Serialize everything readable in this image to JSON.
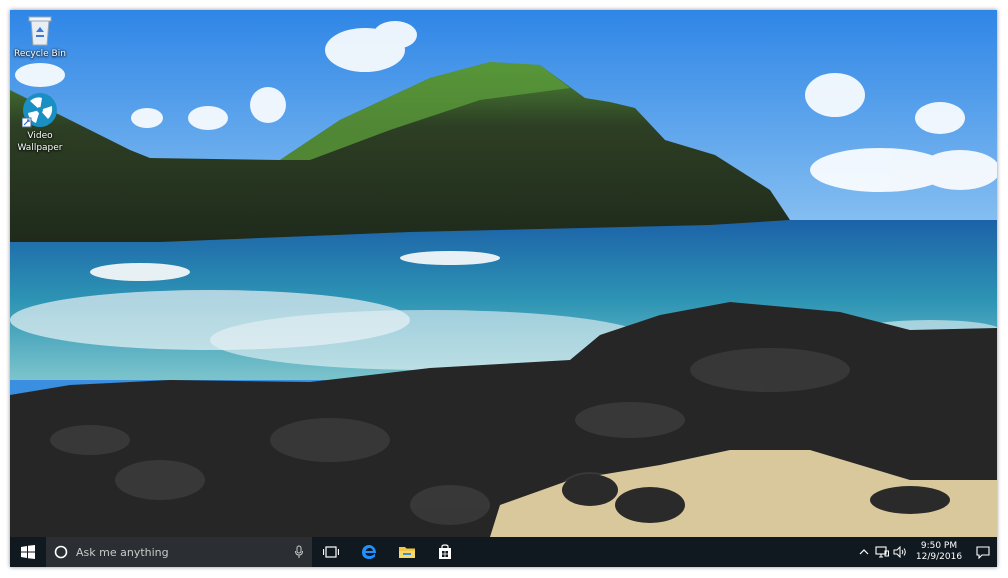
{
  "desktop": {
    "icons": [
      {
        "label": "Recycle Bin",
        "icon": "recycle-bin-icon"
      },
      {
        "label": "Video Wallpaper",
        "icon": "video-wallpaper-icon"
      }
    ],
    "wallpaper": {
      "subject": "ocean-coast-landscape"
    }
  },
  "taskbar": {
    "start_icon": "windows-logo-icon",
    "search_placeholder": "Ask me anything",
    "pinned": [
      {
        "icon": "task-view-icon"
      },
      {
        "icon": "edge-icon"
      },
      {
        "icon": "file-explorer-icon"
      },
      {
        "icon": "store-icon"
      }
    ],
    "tray": {
      "time": "9:50 PM",
      "date": "12/9/2016",
      "icons": [
        "show-hidden-icons-icon",
        "network-icon",
        "volume-icon",
        "action-center-icon"
      ]
    }
  },
  "colors": {
    "taskbar_bg": "#101820",
    "search_bg": "#2b2f33",
    "accent": "#1e90ff"
  }
}
